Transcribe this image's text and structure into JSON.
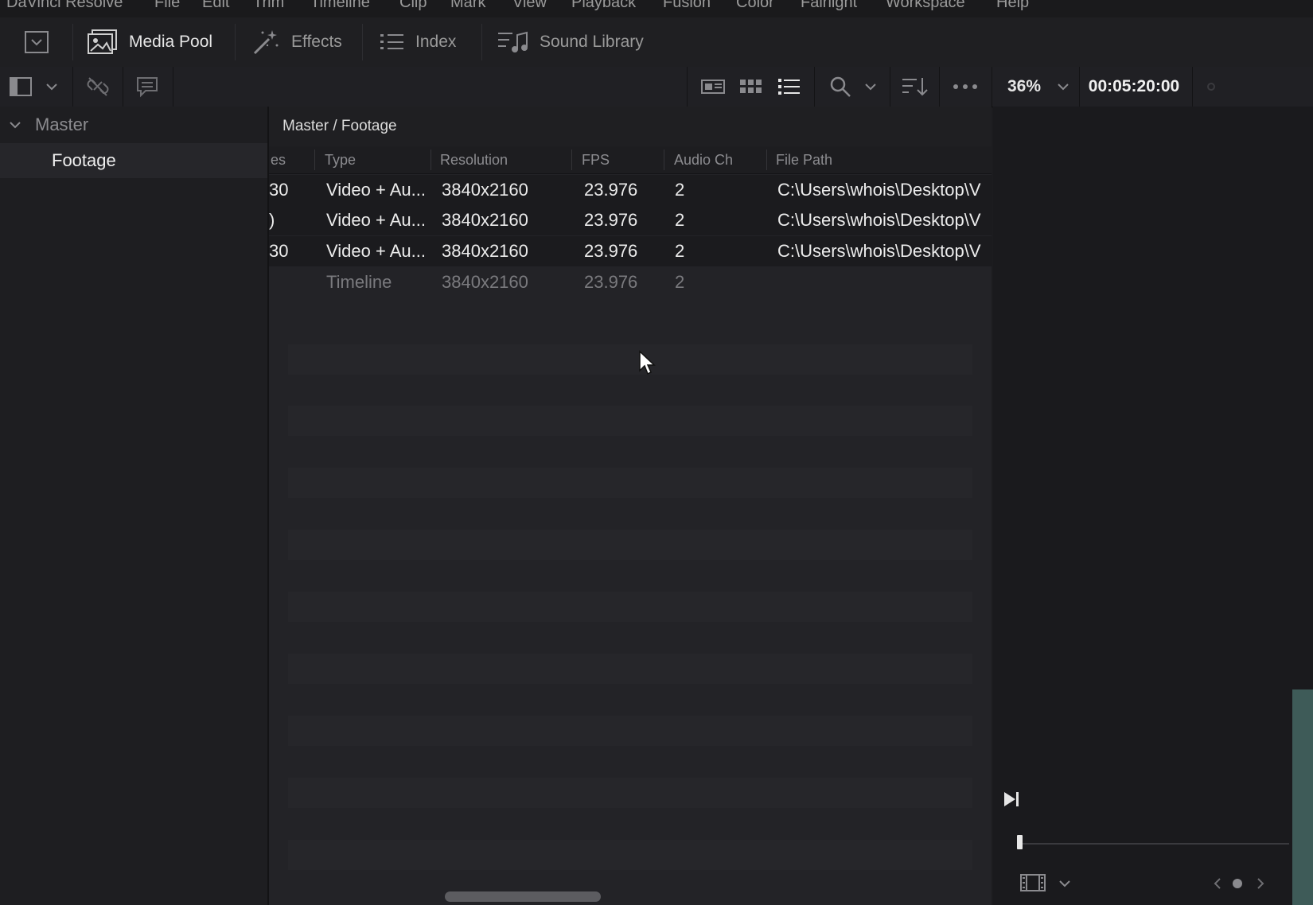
{
  "menu": [
    "DaVinci Resolve",
    "File",
    "Edit",
    "Trim",
    "Timeline",
    "Clip",
    "Mark",
    "View",
    "Playback",
    "Fusion",
    "Color",
    "Fairlight",
    "Workspace",
    "Help"
  ],
  "modes": [
    {
      "label": "Media Pool",
      "icon": "media-pool-icon",
      "active": true
    },
    {
      "label": "Effects",
      "icon": "effects-wand-icon",
      "active": false
    },
    {
      "label": "Index",
      "icon": "index-list-icon",
      "active": false
    },
    {
      "label": "Sound Library",
      "icon": "sound-library-icon",
      "active": false
    }
  ],
  "toolbar": {
    "zoom": "36%",
    "timecode": "00:05:20:00"
  },
  "bins": {
    "master": "Master",
    "footage": "Footage"
  },
  "breadcrumb": "Master / Footage",
  "columns": {
    "frames_partial": "es",
    "type": "Type",
    "resolution": "Resolution",
    "fps": "FPS",
    "audio_ch": "Audio Ch",
    "file_path": "File Path"
  },
  "clips": [
    {
      "frames": "30",
      "type": "Video + Au...",
      "resolution": "3840x2160",
      "fps": "23.976",
      "audio": "2",
      "path": "C:\\Users\\whois\\Desktop\\V"
    },
    {
      "frames": ")",
      "type": "Video + Au...",
      "resolution": "3840x2160",
      "fps": "23.976",
      "audio": "2",
      "path": "C:\\Users\\whois\\Desktop\\V"
    },
    {
      "frames": "30",
      "type": "Video + Au...",
      "resolution": "3840x2160",
      "fps": "23.976",
      "audio": "2",
      "path": "C:\\Users\\whois\\Desktop\\V"
    },
    {
      "frames": "",
      "type": "Timeline",
      "resolution": "3840x2160",
      "fps": "23.976",
      "audio": "2",
      "path": ""
    }
  ],
  "colors": {
    "background": "#1c1c1f",
    "panel": "#232327",
    "text": "#ececec",
    "muted": "#8c8c90",
    "accent_teal": "#3e5b58"
  }
}
